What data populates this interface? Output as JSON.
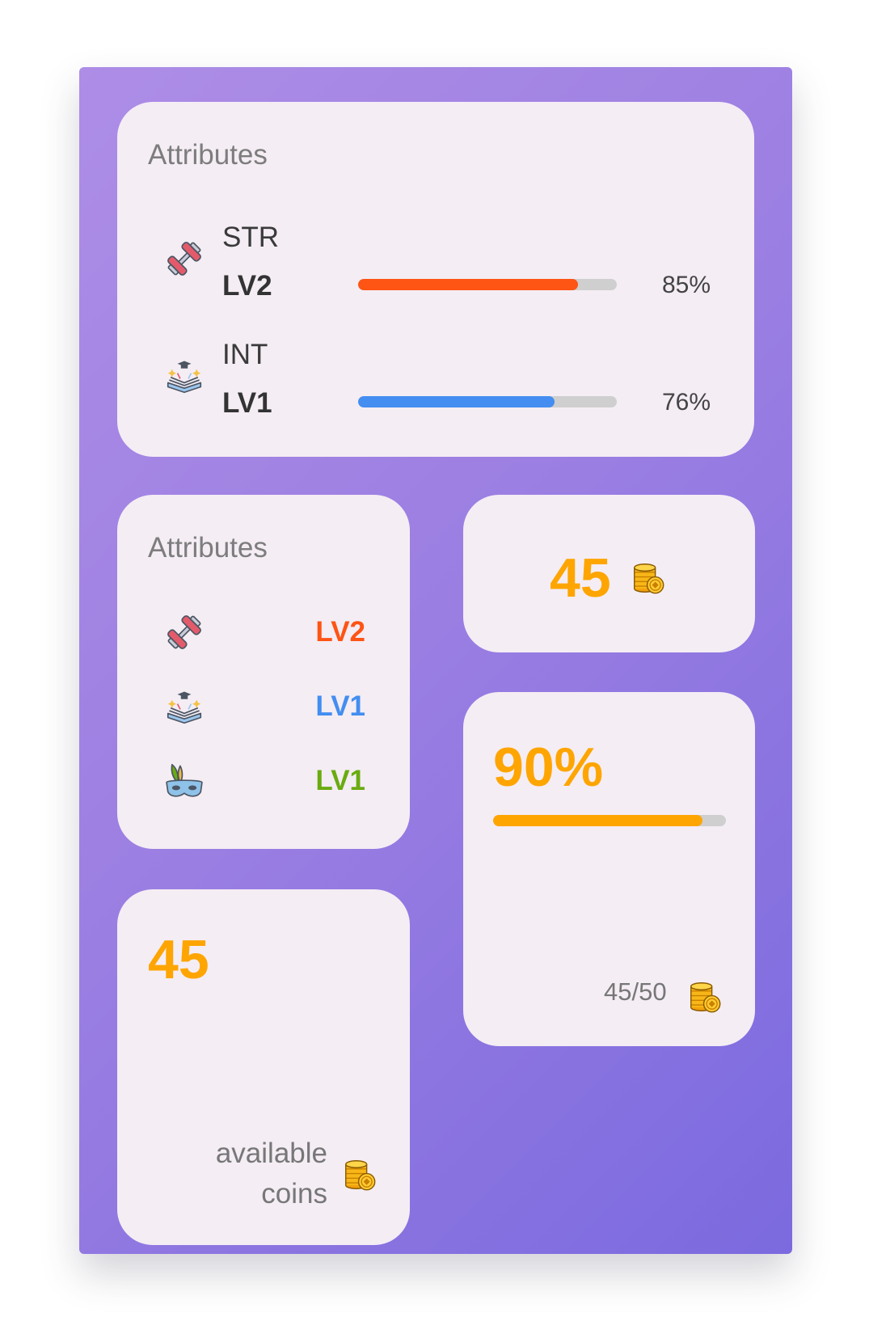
{
  "colors": {
    "accent": "#fea502",
    "str": "#fe5414",
    "int": "#438ef0",
    "cha": "#6aab10",
    "track": "#cfcfcf"
  },
  "attributes_card": {
    "title": "Attributes",
    "rows": [
      {
        "icon": "dumbbell-icon",
        "name": "STR",
        "level": "LV2",
        "percent_label": "85%",
        "percent": 85
      },
      {
        "icon": "magic-book-icon",
        "name": "INT",
        "level": "LV1",
        "percent_label": "76%",
        "percent": 76
      }
    ]
  },
  "levels_card": {
    "title": "Attributes",
    "rows": [
      {
        "icon": "dumbbell-icon",
        "level": "LV2"
      },
      {
        "icon": "magic-book-icon",
        "level": "LV1"
      },
      {
        "icon": "feather-mask-icon",
        "level": "LV1"
      }
    ]
  },
  "coins_card": {
    "value": "45",
    "icon": "coin-stack-icon"
  },
  "progress_card": {
    "percent_label": "90%",
    "percent": 90,
    "fraction_label": "45/50",
    "icon": "coin-stack-icon"
  },
  "available_card": {
    "value": "45",
    "label_line1": "available",
    "label_line2": "coins",
    "icon": "coin-stack-icon"
  }
}
